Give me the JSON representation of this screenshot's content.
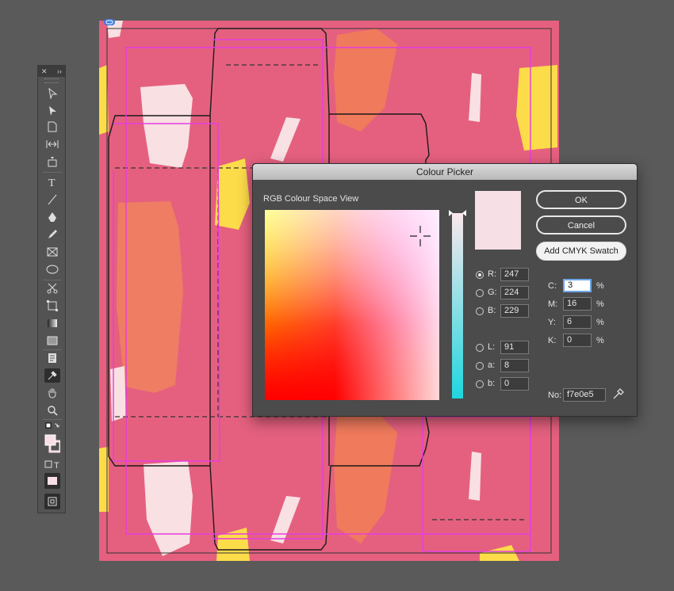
{
  "tools_panel": {
    "close_label": "✕",
    "collapse_label": "››",
    "tools": [
      "selection-tool",
      "direct-selection-tool",
      "page-tool",
      "gap-tool",
      "content-collector-tool",
      "type-tool",
      "line-tool",
      "pen-tool",
      "pencil-tool",
      "rectangle-frame-tool",
      "ellipse-tool",
      "scissors-tool",
      "free-transform-tool",
      "gradient-swatch-tool",
      "gradient-feather-tool",
      "note-tool",
      "eyedropper-tool",
      "hand-tool",
      "zoom-tool"
    ],
    "fill_color": "#f7e0e5",
    "format_container_label": "T"
  },
  "colour_picker": {
    "title": "Colour Picker",
    "space_label": "RGB Colour Space View",
    "ok_label": "OK",
    "cancel_label": "Cancel",
    "add_swatch_label": "Add CMYK Swatch",
    "selected_color": "#f7e0e5",
    "rgb": {
      "r_label": "R:",
      "r": "247",
      "g_label": "G:",
      "g": "224",
      "b_label": "B:",
      "b": "229"
    },
    "lab": {
      "l_label": "L:",
      "l": "91",
      "a_label": "a:",
      "a": "8",
      "b_label": "b:",
      "b": "0"
    },
    "cmyk": {
      "c_label": "C:",
      "c": "3",
      "m_label": "M:",
      "m": "16",
      "y_label": "Y:",
      "y": "6",
      "k_label": "K:",
      "k": "0",
      "unit": "%"
    },
    "hex_label": "No:",
    "hex": "f7e0e5",
    "active_channel": "R"
  },
  "document": {
    "background": "#e5607f"
  }
}
